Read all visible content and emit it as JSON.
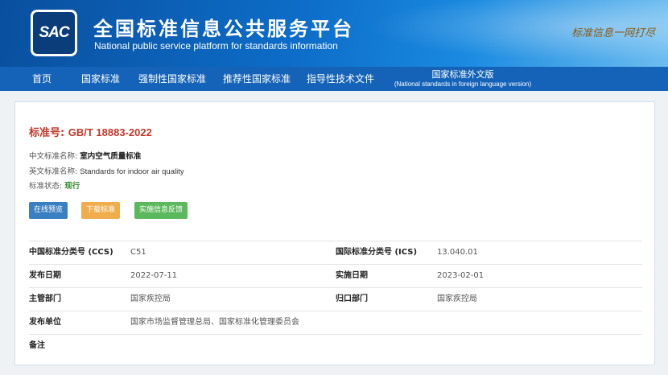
{
  "header": {
    "logo_text": "SAC",
    "title": "全国标准信息公共服务平台",
    "subtitle": "National public service platform  for standards information",
    "slogan": "标准信息一网打尽"
  },
  "nav": {
    "items": [
      "首页",
      "国家标准",
      "强制性国家标准",
      "推荐性国家标准",
      "指导性技术文件"
    ],
    "foreign_label": "国家标准外文版",
    "foreign_sublabel": "(National standards in foreign language version)"
  },
  "standard": {
    "number_label": "标准号:",
    "number": "GB/T 18883-2022",
    "cn_name_label": "中文标准名称:",
    "cn_name": "室内空气质量标准",
    "en_name_label": "英文标准名称:",
    "en_name": "Standards for indoor air quality",
    "status_label": "标准状态:",
    "status": "现行"
  },
  "buttons": {
    "preview": "在线预览",
    "download": "下载标准",
    "feedback": "实施信息反馈"
  },
  "details": [
    {
      "label1": "中国标准分类号 (CCS)",
      "value1": "C51",
      "label2": "国际标准分类号 (ICS)",
      "value2": "13.040.01"
    },
    {
      "label1": "发布日期",
      "value1": "2022-07-11",
      "label2": "实施日期",
      "value2": "2023-02-01"
    },
    {
      "label1": "主管部门",
      "value1": "国家疾控局",
      "label2": "归口部门",
      "value2": "国家疾控局"
    },
    {
      "label1": "发布单位",
      "value1": "国家市场监督管理总局、国家标准化管理委员会",
      "label2": "",
      "value2": ""
    },
    {
      "label1": "备注",
      "value1": "",
      "label2": "",
      "value2": ""
    }
  ]
}
